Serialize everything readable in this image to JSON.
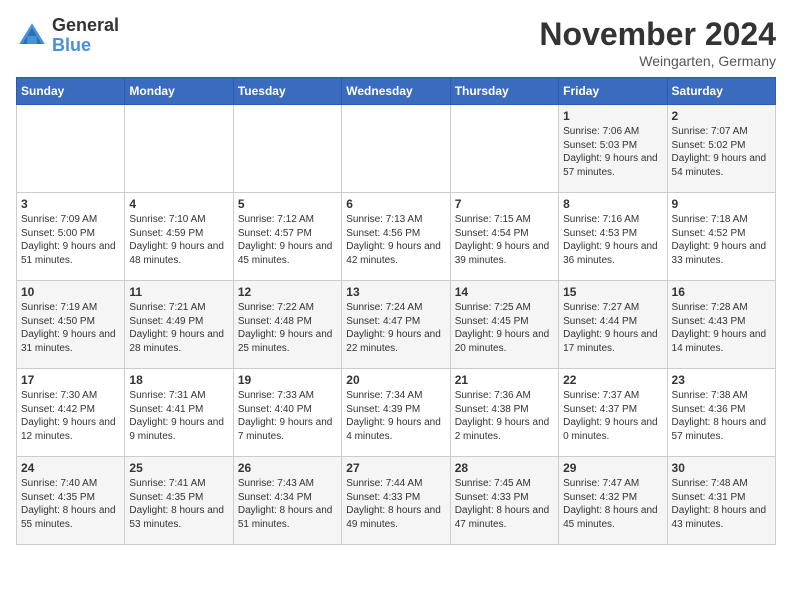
{
  "logo": {
    "general": "General",
    "blue": "Blue"
  },
  "title": "November 2024",
  "location": "Weingarten, Germany",
  "days_of_week": [
    "Sunday",
    "Monday",
    "Tuesday",
    "Wednesday",
    "Thursday",
    "Friday",
    "Saturday"
  ],
  "weeks": [
    [
      {
        "day": "",
        "info": ""
      },
      {
        "day": "",
        "info": ""
      },
      {
        "day": "",
        "info": ""
      },
      {
        "day": "",
        "info": ""
      },
      {
        "day": "",
        "info": ""
      },
      {
        "day": "1",
        "info": "Sunrise: 7:06 AM\nSunset: 5:03 PM\nDaylight: 9 hours and 57 minutes."
      },
      {
        "day": "2",
        "info": "Sunrise: 7:07 AM\nSunset: 5:02 PM\nDaylight: 9 hours and 54 minutes."
      }
    ],
    [
      {
        "day": "3",
        "info": "Sunrise: 7:09 AM\nSunset: 5:00 PM\nDaylight: 9 hours and 51 minutes."
      },
      {
        "day": "4",
        "info": "Sunrise: 7:10 AM\nSunset: 4:59 PM\nDaylight: 9 hours and 48 minutes."
      },
      {
        "day": "5",
        "info": "Sunrise: 7:12 AM\nSunset: 4:57 PM\nDaylight: 9 hours and 45 minutes."
      },
      {
        "day": "6",
        "info": "Sunrise: 7:13 AM\nSunset: 4:56 PM\nDaylight: 9 hours and 42 minutes."
      },
      {
        "day": "7",
        "info": "Sunrise: 7:15 AM\nSunset: 4:54 PM\nDaylight: 9 hours and 39 minutes."
      },
      {
        "day": "8",
        "info": "Sunrise: 7:16 AM\nSunset: 4:53 PM\nDaylight: 9 hours and 36 minutes."
      },
      {
        "day": "9",
        "info": "Sunrise: 7:18 AM\nSunset: 4:52 PM\nDaylight: 9 hours and 33 minutes."
      }
    ],
    [
      {
        "day": "10",
        "info": "Sunrise: 7:19 AM\nSunset: 4:50 PM\nDaylight: 9 hours and 31 minutes."
      },
      {
        "day": "11",
        "info": "Sunrise: 7:21 AM\nSunset: 4:49 PM\nDaylight: 9 hours and 28 minutes."
      },
      {
        "day": "12",
        "info": "Sunrise: 7:22 AM\nSunset: 4:48 PM\nDaylight: 9 hours and 25 minutes."
      },
      {
        "day": "13",
        "info": "Sunrise: 7:24 AM\nSunset: 4:47 PM\nDaylight: 9 hours and 22 minutes."
      },
      {
        "day": "14",
        "info": "Sunrise: 7:25 AM\nSunset: 4:45 PM\nDaylight: 9 hours and 20 minutes."
      },
      {
        "day": "15",
        "info": "Sunrise: 7:27 AM\nSunset: 4:44 PM\nDaylight: 9 hours and 17 minutes."
      },
      {
        "day": "16",
        "info": "Sunrise: 7:28 AM\nSunset: 4:43 PM\nDaylight: 9 hours and 14 minutes."
      }
    ],
    [
      {
        "day": "17",
        "info": "Sunrise: 7:30 AM\nSunset: 4:42 PM\nDaylight: 9 hours and 12 minutes."
      },
      {
        "day": "18",
        "info": "Sunrise: 7:31 AM\nSunset: 4:41 PM\nDaylight: 9 hours and 9 minutes."
      },
      {
        "day": "19",
        "info": "Sunrise: 7:33 AM\nSunset: 4:40 PM\nDaylight: 9 hours and 7 minutes."
      },
      {
        "day": "20",
        "info": "Sunrise: 7:34 AM\nSunset: 4:39 PM\nDaylight: 9 hours and 4 minutes."
      },
      {
        "day": "21",
        "info": "Sunrise: 7:36 AM\nSunset: 4:38 PM\nDaylight: 9 hours and 2 minutes."
      },
      {
        "day": "22",
        "info": "Sunrise: 7:37 AM\nSunset: 4:37 PM\nDaylight: 9 hours and 0 minutes."
      },
      {
        "day": "23",
        "info": "Sunrise: 7:38 AM\nSunset: 4:36 PM\nDaylight: 8 hours and 57 minutes."
      }
    ],
    [
      {
        "day": "24",
        "info": "Sunrise: 7:40 AM\nSunset: 4:35 PM\nDaylight: 8 hours and 55 minutes."
      },
      {
        "day": "25",
        "info": "Sunrise: 7:41 AM\nSunset: 4:35 PM\nDaylight: 8 hours and 53 minutes."
      },
      {
        "day": "26",
        "info": "Sunrise: 7:43 AM\nSunset: 4:34 PM\nDaylight: 8 hours and 51 minutes."
      },
      {
        "day": "27",
        "info": "Sunrise: 7:44 AM\nSunset: 4:33 PM\nDaylight: 8 hours and 49 minutes."
      },
      {
        "day": "28",
        "info": "Sunrise: 7:45 AM\nSunset: 4:33 PM\nDaylight: 8 hours and 47 minutes."
      },
      {
        "day": "29",
        "info": "Sunrise: 7:47 AM\nSunset: 4:32 PM\nDaylight: 8 hours and 45 minutes."
      },
      {
        "day": "30",
        "info": "Sunrise: 7:48 AM\nSunset: 4:31 PM\nDaylight: 8 hours and 43 minutes."
      }
    ]
  ]
}
